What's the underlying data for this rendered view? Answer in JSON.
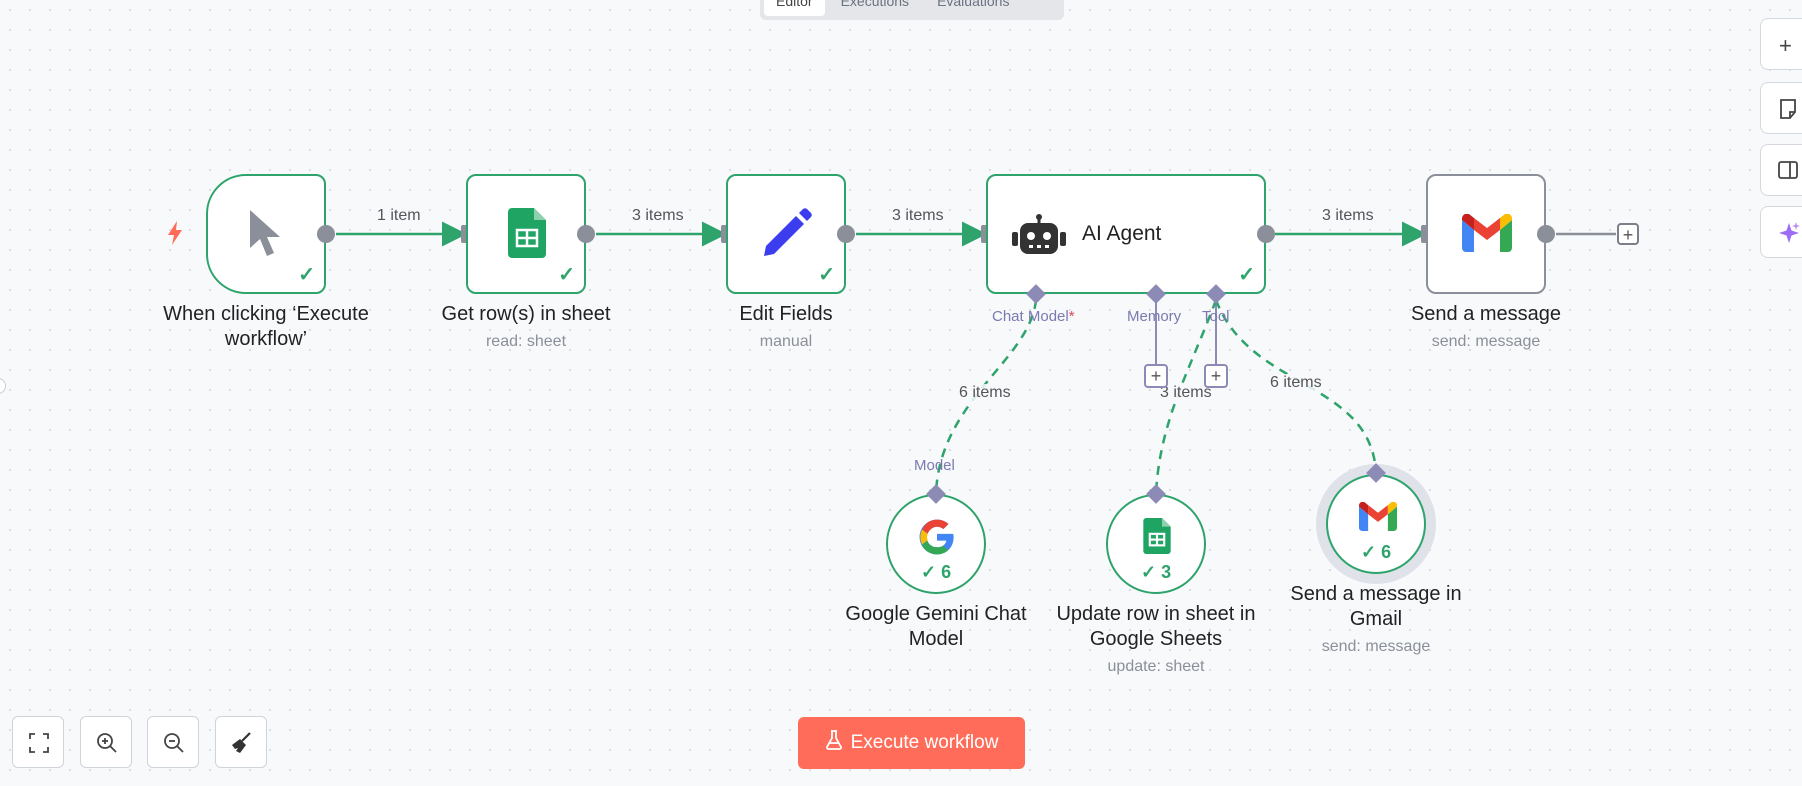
{
  "tabs": [
    "Editor",
    "Executions",
    "Evaluations"
  ],
  "edges": {
    "trigger_to_sheet": "1 item",
    "sheet_to_edit": "3 items",
    "edit_to_agent": "3 items",
    "agent_to_send": "3 items",
    "model_link": "6 items",
    "tool_sheet_link": "3 items",
    "tool_gmail_link": "6 items"
  },
  "nodes": {
    "trigger": {
      "title": "When clicking ‘Execute workflow’",
      "icon": "cursor-icon"
    },
    "get_rows": {
      "title": "Get row(s) in sheet",
      "subtitle": "read: sheet",
      "icon": "google-sheets-icon"
    },
    "edit_fields": {
      "title": "Edit Fields",
      "subtitle": "manual",
      "icon": "pencil-icon"
    },
    "ai_agent": {
      "title": "AI Agent",
      "icon": "robot-icon",
      "ports": {
        "chat_model": "Chat Model",
        "required_mark": "*",
        "memory": "Memory",
        "tool": "Tool"
      }
    },
    "send_message": {
      "title": "Send a message",
      "subtitle": "send: message",
      "icon": "gmail-icon"
    },
    "gemini": {
      "title": "Google Gemini Chat Model",
      "port_label": "Model",
      "count": "6",
      "icon": "google-icon"
    },
    "update_row": {
      "title": "Update row in sheet in Google Sheets",
      "subtitle": "update: sheet",
      "count": "3",
      "icon": "google-sheets-icon"
    },
    "gmail_tool": {
      "title": "Send a message in Gmail",
      "subtitle": "send: message",
      "count": "6",
      "icon": "gmail-icon"
    }
  },
  "execute_button": "Execute workflow",
  "colors": {
    "success": "#2ea36b",
    "execute": "#ff6d5a",
    "port": "#8b8bb6",
    "pencil": "#3d3df0",
    "sheets": "#1fa463"
  }
}
